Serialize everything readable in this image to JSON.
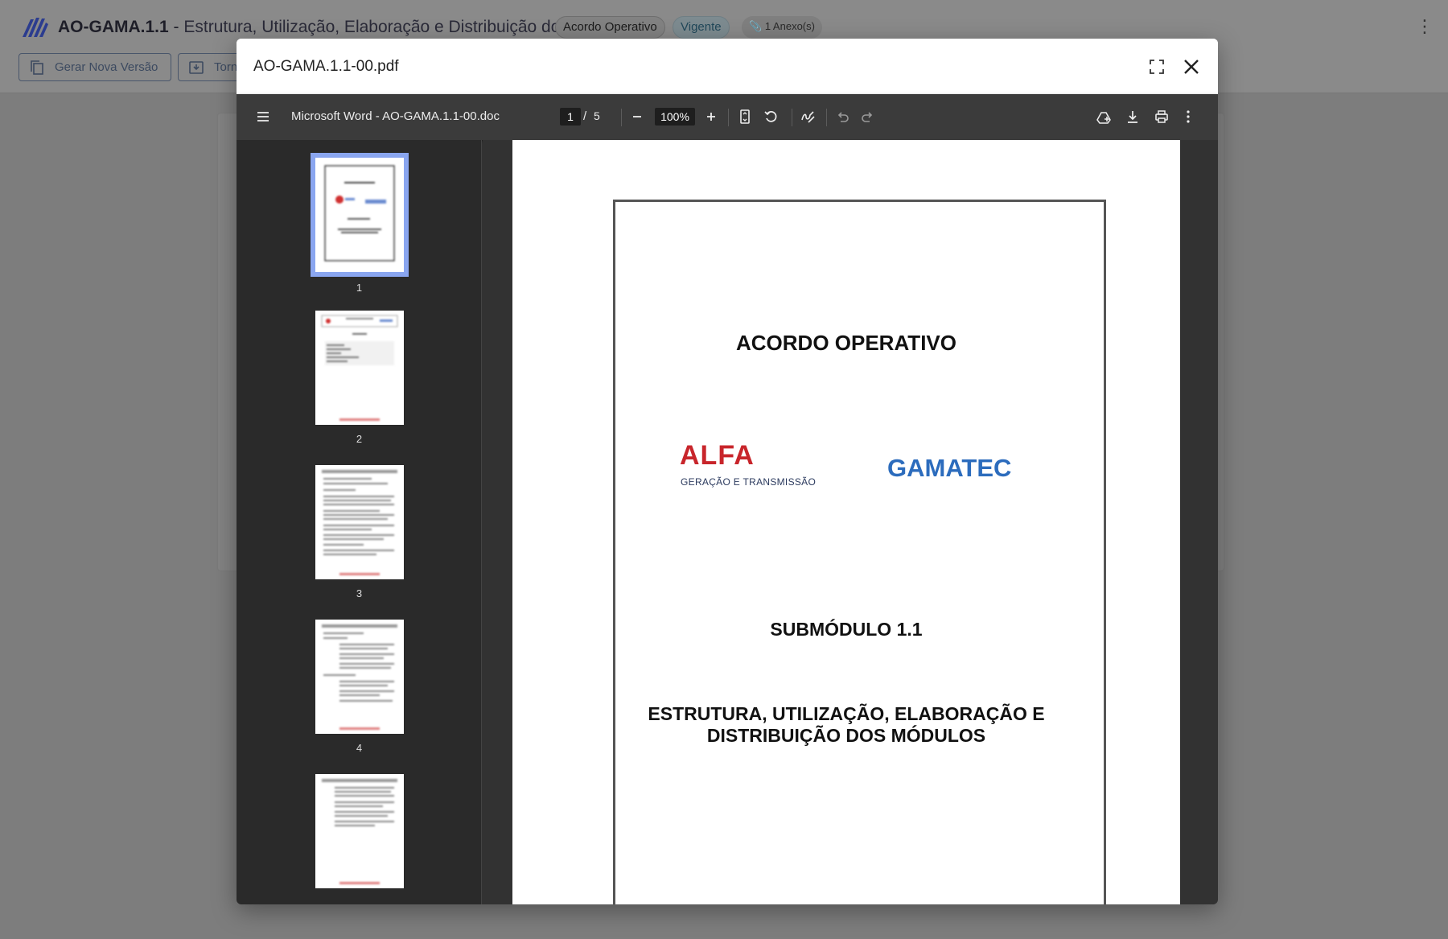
{
  "app": {
    "code": "AO-GAMA.1.1",
    "separator": " - ",
    "title": "Estrutura, Utilização, Elaboração e Distribuição dos ...",
    "type_chip": "Acordo Operativo",
    "status_chip": "Vigente",
    "attachments": "1 Anexo(s)",
    "buttons": {
      "new_version": "Gerar Nova Versão",
      "second": "Torn"
    }
  },
  "modal": {
    "title": "AO-GAMA.1.1-00.pdf"
  },
  "viewer": {
    "doc_name": "Microsoft Word - AO-GAMA.1.1-00.doc",
    "current_page": "1",
    "page_sep": "/",
    "total_pages": "5",
    "zoom": "100%",
    "thumbnails": [
      "1",
      "2",
      "3",
      "4"
    ]
  },
  "document": {
    "title": "ACORDO OPERATIVO",
    "logo_left": "ALFA",
    "logo_left_sub": "GERAÇÃO E TRANSMISSÃO",
    "logo_right": "GAMATEC",
    "submodule": "SUBMÓDULO 1.1",
    "heading_line1": "ESTRUTURA, UTILIZAÇÃO, ELABORAÇÃO E",
    "heading_line2": "DISTRIBUIÇÃO DOS MÓDULOS"
  },
  "colors": {
    "accent_red": "#c8252b",
    "accent_blue": "#2c6cbd",
    "thumb_highlight": "#8aa6f0"
  }
}
